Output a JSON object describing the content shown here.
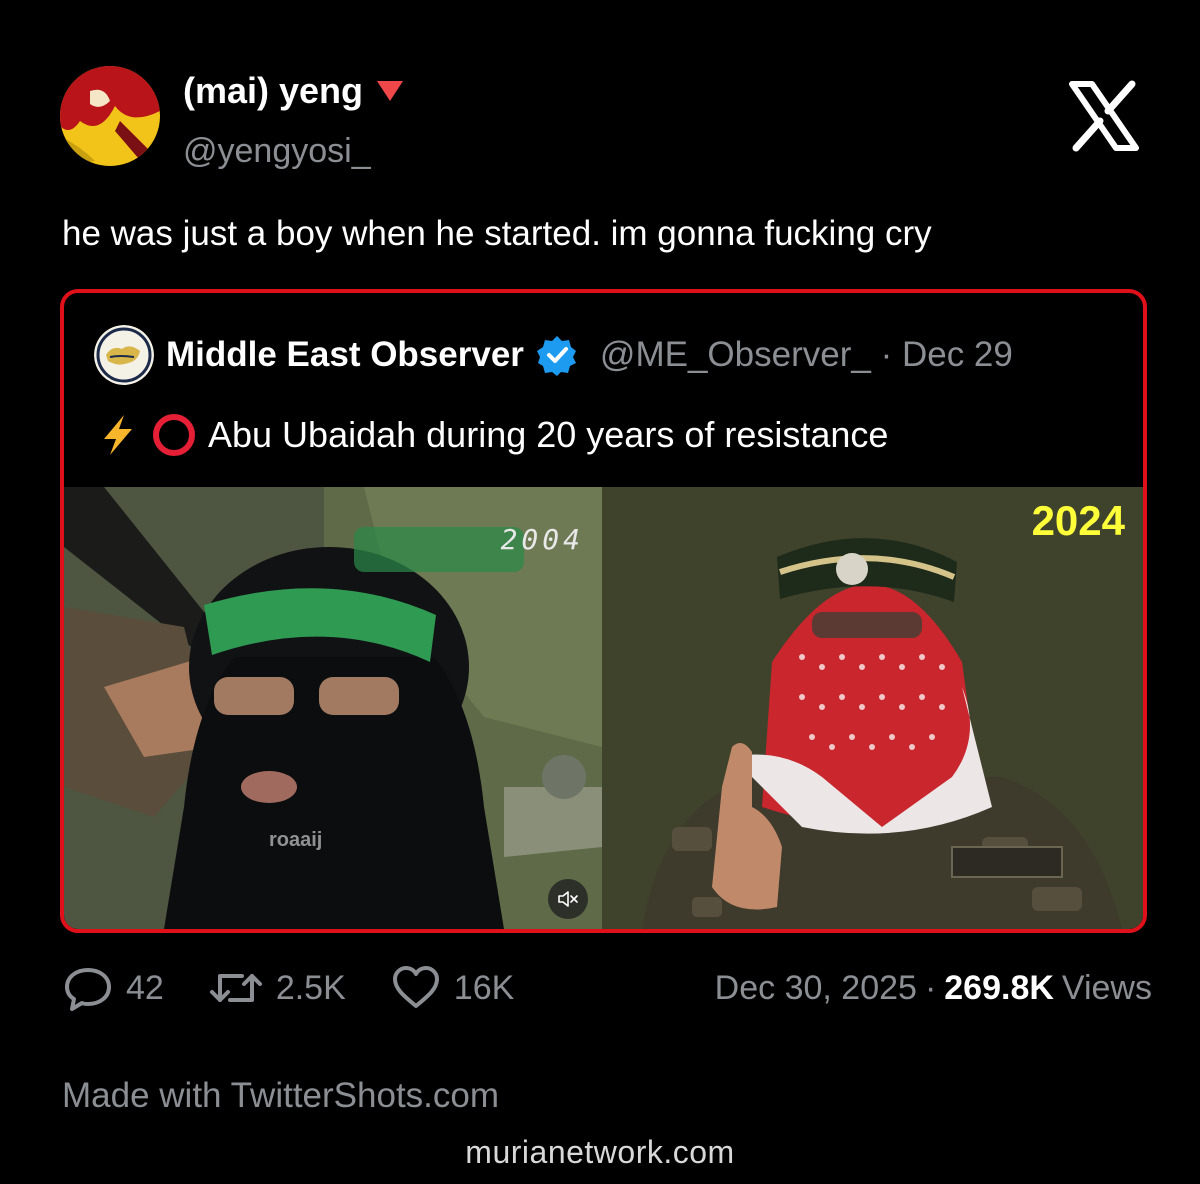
{
  "author": {
    "display_name": "(mai) yeng",
    "handle": "@yengyosi_",
    "avatar_icon": "avatar-image",
    "badge_icon": "red-triangle-icon"
  },
  "platform_icon": "x-logo-icon",
  "tweet": {
    "text": "he was just a boy when he started. im gonna fucking cry"
  },
  "quote": {
    "display_name": "Middle East Observer",
    "verified_icon": "verified-badge-icon",
    "handle": "@ME_Observer_",
    "separator": "·",
    "date": "Dec 29",
    "text": "Abu Ubaidah during 20 years of resistance",
    "emoji": [
      "⚡",
      "⭕"
    ],
    "media": {
      "left_year": "2004",
      "left_watermark": "roaaij",
      "right_year": "2024",
      "mute_icon": "speaker-muted-icon"
    }
  },
  "actions": {
    "replies": "42",
    "reposts": "2.5K",
    "likes": "16K"
  },
  "meta": {
    "date": "Dec 30, 2025",
    "separator": "·",
    "views_count": "269.8K",
    "views_label": "Views"
  },
  "footer": {
    "made_with": "Made with TwitterShots.com",
    "site_watermark": "murianetwork.com"
  },
  "colors": {
    "background": "#000000",
    "text_primary": "#ffffff",
    "text_secondary": "#8b8f94",
    "highlight_border": "#e0101a",
    "verified_blue": "#1d9bf0",
    "year_yellow": "#ffff3a"
  }
}
